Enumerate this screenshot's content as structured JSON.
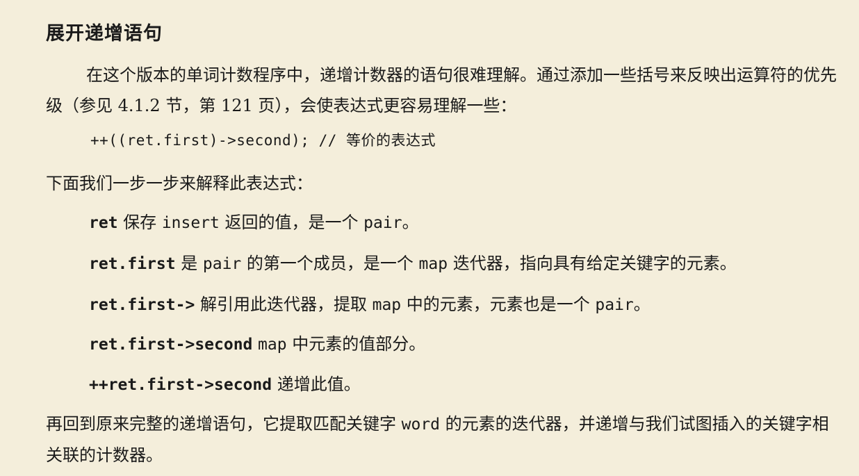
{
  "heading": "展开递增语句",
  "intro": "在这个版本的单词计数程序中，递增计数器的语句很难理解。通过添加一些括号来反映出运算符的优先级（参见 4.1.2 节，第 121 页），会使表达式更容易理解一些：",
  "code": "++((ret.first)->second); // 等价的表达式",
  "explain_intro": "下面我们一步一步来解释此表达式：",
  "items": [
    {
      "term": "ret",
      "t1": " 保存 ",
      "c1": "insert",
      "t2": " 返回的值，是一个 ",
      "c2": "pair",
      "t3": "。"
    },
    {
      "term": "ret.first",
      "t1": " 是 ",
      "c1": "pair",
      "t2": " 的第一个成员，是一个 ",
      "c2": "map",
      "t3": " 迭代器，指向具有给定关键字的元素。"
    },
    {
      "term": "ret.first->",
      "t1": " 解引用此迭代器，提取 ",
      "c1": "map",
      "t2": " 中的元素，元素也是一个 ",
      "c2": "pair",
      "t3": "。"
    },
    {
      "term": "ret.first->second",
      "t1": " ",
      "c1": "map",
      "t2": " 中元素的值部分。",
      "c2": "",
      "t3": ""
    },
    {
      "term": "++ret.first->second",
      "t1": " 递增此值。",
      "c1": "",
      "t2": "",
      "c2": "",
      "t3": ""
    }
  ],
  "conclusion": {
    "before": "再回到原来完整的递增语句，它提取匹配关键字 ",
    "code": "word",
    "after": " 的元素的迭代器，并递增与我们试图插入的关键字相关联的计数器。"
  }
}
